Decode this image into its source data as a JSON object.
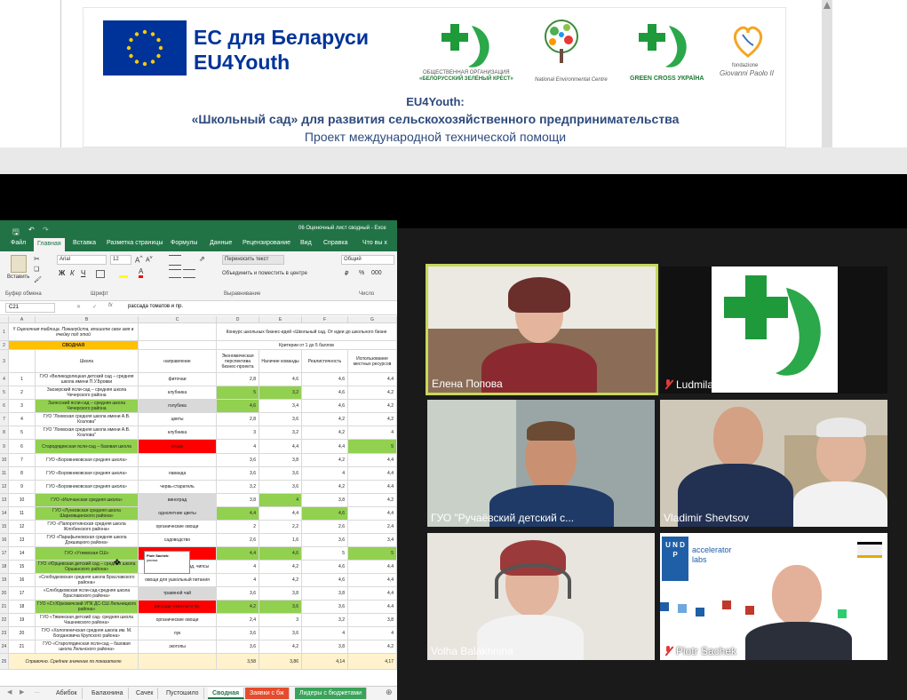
{
  "banner": {
    "eu_title": "ЕС для Беларуси",
    "eu_sub": "EU4Youth",
    "logo1_caption_1": "ОБЩЕСТВЕННАЯ ОРГАНИЗАЦИЯ",
    "logo1_caption_2": "«БЕЛОРУССКИЙ ЗЕЛЁНЫЙ КРЕСТ»",
    "logo2_caption": "National Environmental Centre",
    "logo3_caption": "GREEN CROSS УКРАЇНА",
    "logo4_caption_1": "fondazione",
    "logo4_caption_2": "Giovanni Paolo II",
    "title_1": "EU4Youth:",
    "title_2": "«Школьный сад» для развития сельскохозяйственного предпринимательства",
    "title_3": "Проект международной технической помощи"
  },
  "excel": {
    "doc_title": "06 Оценочный лист сводный - Exce",
    "tabs": [
      "Файл",
      "Главная",
      "Вставка",
      "Разметка страницы",
      "Формулы",
      "Данные",
      "Рецензирование",
      "Вид",
      "Справка",
      "Что вы х"
    ],
    "font_name": "Arial",
    "font_size": "12",
    "wrap_text": "Переносить текст",
    "merge_center": "Объединить и поместить в центре",
    "number_format": "Общий",
    "paste_label": "Вставить",
    "group_clipboard": "Буфер обмена",
    "group_font": "Шрифт",
    "group_align": "Выравнивание",
    "group_number": "Число",
    "cell_ref": "C21",
    "formula_value": "рассада томатов и пр.",
    "columns": [
      "A",
      "B",
      "C",
      "D",
      "E",
      "F",
      "G"
    ],
    "header_note": "!! Оценочная таблица. Пожалуйста, впишите свое имя в ячейку под этой",
    "header_contest": "Конкурс школьных бизнес-идей «Школьный сад. От идеи до школьного бизне",
    "svodnaya": "СВОДНАЯ",
    "criteria": "Критерии от 1 до 5 баллов",
    "col_school": "Школа",
    "col_direction": "направление",
    "col_econ": "Экономическая перспектива бизнес-проекта",
    "col_team": "Наличие команды",
    "col_real": "Реалистичность",
    "col_local": "Использование местных ресурсов",
    "rows": [
      {
        "n": "1",
        "school": "ГУО «Великодолецкая детский сад – средняя школа имени П.У.Бровки",
        "dir": "фиточаи",
        "d": "2,8",
        "e": "4,6",
        "f": "4,6",
        "g": "4,4"
      },
      {
        "n": "2",
        "school": "Заозерский ясли-сад – средняя школа Чечерского района",
        "dir": "клубника",
        "d": "5",
        "e": "3,2",
        "f": "4,6",
        "g": "4,2"
      },
      {
        "n": "3",
        "school": "Залесский ясли-сад – средняя школа Чечерского района",
        "dir": "голубика",
        "d": "4,6",
        "e": "3,4",
        "f": "4,6",
        "g": "4,2"
      },
      {
        "n": "4",
        "school": "ГУО \"Лоевская средняя школа имени А.В. Козлова\"",
        "dir": "цветы",
        "d": "2,8",
        "e": "3,6",
        "f": "4,2",
        "g": "4,2"
      },
      {
        "n": "5",
        "school": "ГУО \"Лоевская средняя школа имени А.В. Козлова\"",
        "dir": "клубника",
        "d": "3",
        "e": "3,2",
        "f": "4,2",
        "g": "4"
      },
      {
        "n": "6",
        "school": "Стародядинская ясли-сад – базовая школа",
        "dir": "ягоды",
        "d": "4",
        "e": "4,4",
        "f": "4,4",
        "g": "5"
      },
      {
        "n": "7",
        "school": "ГУО «Боровниковская средняя школа»",
        "dir": "",
        "d": "3,6",
        "e": "3,8",
        "f": "4,2",
        "g": "4,4"
      },
      {
        "n": "8",
        "school": "ГУО «Боровниковская средняя школа»",
        "dir": "лаванда",
        "d": "3,6",
        "e": "3,6",
        "f": "4",
        "g": "4,4"
      },
      {
        "n": "9",
        "school": "ГУО «Боровниковская средняя школа»",
        "dir": "червь-старатель",
        "d": "3,2",
        "e": "3,6",
        "f": "4,2",
        "g": "4,4"
      },
      {
        "n": "10",
        "school": "ГУО «Иолчанская средняя школа»",
        "dir": "виноград",
        "d": "3,8",
        "e": "4",
        "f": "3,8",
        "g": "4,2"
      },
      {
        "n": "11",
        "school": "ГУО «Лунковская средняя школа Шарковщинского района»",
        "dir": "однолетние цветы",
        "d": "4,4",
        "e": "4,4",
        "f": "4,6",
        "g": "4,4"
      },
      {
        "n": "12",
        "school": "ГУО «Папоротнянская средняя школа Жлобинского района»",
        "dir": "органические овощи",
        "d": "2",
        "e": "2,2",
        "f": "2,6",
        "g": "2,4"
      },
      {
        "n": "13",
        "school": "ГУО «Парафьяновская средняя школа Докшицкого района»",
        "dir": "садоводство",
        "d": "2,6",
        "e": "1,6",
        "f": "3,6",
        "g": "3,4"
      },
      {
        "n": "14",
        "school": "ГУО «Утиевская СШ»",
        "dir": "сухофрукты",
        "d": "4,4",
        "e": "4,6",
        "f": "5",
        "g": "5"
      },
      {
        "n": "15",
        "school": "ГУО «Юрцевская детский сад – средняя школа Оршанского района»",
        "dir": "сухофрукты, мармелад, чипсы",
        "d": "4",
        "e": "4,2",
        "f": "4,6",
        "g": "4,4"
      },
      {
        "n": "16",
        "school": "«Слободковская средняя школа Браславского района»",
        "dir": "овощи для ушкольный питания",
        "d": "4",
        "e": "4,2",
        "f": "4,6",
        "g": "4,4"
      },
      {
        "n": "17",
        "school": "«Слободковская ясли-сад-средняя школа Браславского района»",
        "dir": "травяной чай",
        "d": "3,6",
        "e": "3,8",
        "f": "3,8",
        "g": "4,4"
      },
      {
        "n": "18",
        "school": "ГУО «Ст.Юрковичский УПК ДС-СШ Лельчицкого района»",
        "dir": "рассада томатов и пр.",
        "d": "4,2",
        "e": "3,6",
        "f": "3,6",
        "g": "4,4"
      },
      {
        "n": "19",
        "school": "ГУО «Тявинская детский сад- средняя школа Чашникского района»",
        "dir": "органические овощи",
        "d": "2,4",
        "e": "3",
        "f": "3,2",
        "g": "3,8"
      },
      {
        "n": "20",
        "school": "ГУО «Холопеничская средняя школа им. М. Богдановича Крупского района»",
        "dir": "лук",
        "d": "3,6",
        "e": "3,6",
        "f": "4",
        "g": "4"
      },
      {
        "n": "21",
        "school": "ГУО «Старолядинская ясли-сад – базовая школа Лельчского района»",
        "dir": "экотопы",
        "d": "3,6",
        "e": "4,2",
        "f": "3,8",
        "g": "4,2"
      }
    ],
    "avg_label": "Справочно. Среднее значение по показателю",
    "avg_d": "3,58",
    "avg_e": "3,86",
    "avg_f": "4,14",
    "avg_g": "4,17",
    "comment_author": "Piotr Sachek:",
    "comment_text": "улитки",
    "sheets": [
      "Абибок",
      "Балахнина",
      "Сачек",
      "Пустошило",
      "Сводная",
      "Заявки с бж",
      "Лидеры с бюджетами"
    ]
  },
  "zoom": {
    "participants": [
      {
        "name": "Елена Попова",
        "muted": false
      },
      {
        "name": "Ludmila Skakun GCBY",
        "muted": true
      },
      {
        "name": "ГУО \"Ручаёвский детский с...",
        "muted": false
      },
      {
        "name": "Vladimir Shevtsov",
        "muted": false
      },
      {
        "name": "Volha Balakhnina",
        "muted": false
      },
      {
        "name": "Piotr Sachek",
        "muted": true
      }
    ],
    "undp_logo": "U N D P",
    "accel_1": "accelerator",
    "accel_2": "labs"
  }
}
